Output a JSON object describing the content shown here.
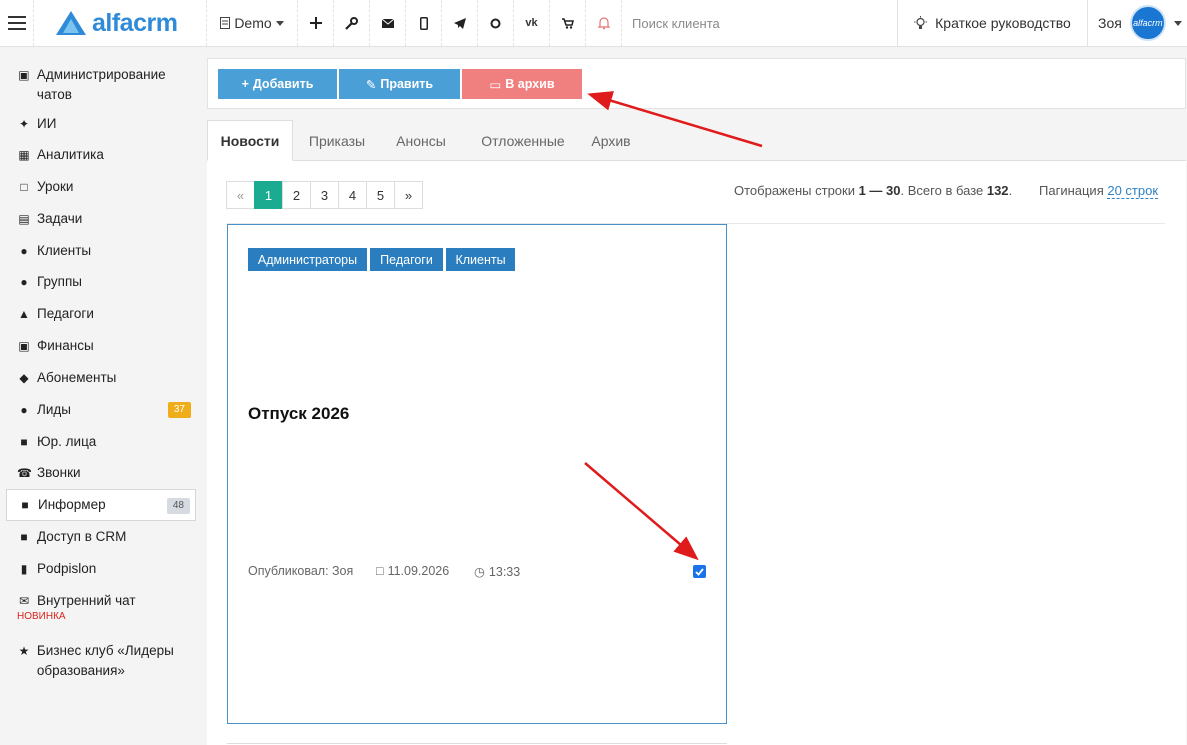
{
  "topbar": {
    "logo_text": "alfacrm",
    "branch": "Demo",
    "search_placeholder": "Поиск клиента",
    "guide_label": "Краткое руководство",
    "user_name": "Зоя",
    "avatar_text": "alfacrm"
  },
  "sidebar": {
    "items": [
      {
        "label": "Администрирование чатов",
        "icon": "chat-admin-icon"
      },
      {
        "label": "ИИ",
        "icon": "sparkle-icon"
      },
      {
        "label": "Аналитика",
        "icon": "map-icon"
      },
      {
        "label": "Уроки",
        "icon": "calendar-icon"
      },
      {
        "label": "Задачи",
        "icon": "clipboard-icon"
      },
      {
        "label": "Клиенты",
        "icon": "user-icon"
      },
      {
        "label": "Группы",
        "icon": "users-icon"
      },
      {
        "label": "Педагоги",
        "icon": "graduation-cap-icon"
      },
      {
        "label": "Финансы",
        "icon": "money-icon"
      },
      {
        "label": "Абонементы",
        "icon": "tag-icon"
      },
      {
        "label": "Лиды",
        "icon": "user-plus-icon",
        "badge": "37"
      },
      {
        "label": "Юр. лица",
        "icon": "briefcase-icon"
      },
      {
        "label": "Звонки",
        "icon": "phone-icon"
      },
      {
        "label": "Информер",
        "icon": "book-icon",
        "badge": "48"
      },
      {
        "label": "Доступ в CRM",
        "icon": "lock-icon"
      },
      {
        "label": "Podpislon",
        "icon": "file-icon"
      },
      {
        "label": "Внутренний чат",
        "icon": "envelope-icon",
        "note": "НОВИНКА"
      },
      {
        "label": "Бизнес клуб «Лидеры образования»",
        "icon": "star-icon"
      }
    ]
  },
  "toolbar": {
    "add_label": "Добавить",
    "edit_label": "Править",
    "archive_label": "В архив"
  },
  "tabs": [
    "Новости",
    "Приказы",
    "Анонсы",
    "Отложенные",
    "Архив"
  ],
  "pager": {
    "prev": "«",
    "pages": [
      "1",
      "2",
      "3",
      "4",
      "5"
    ],
    "next": "»",
    "current": "1"
  },
  "rows_info": {
    "prefix": "Отображены строки ",
    "range": "1 — 30",
    "middle": ". Всего в базе ",
    "total": "132",
    "suffix": "."
  },
  "pagination": {
    "label": "Пагинация ",
    "value": "20 строк"
  },
  "news_card": {
    "tags": [
      "Администраторы",
      "Педагоги",
      "Клиенты"
    ],
    "title": "Отпуск 2026",
    "author": "Опубликовал: Зоя",
    "date": "11.09.2026",
    "time": "13:33",
    "checked": true
  },
  "colors": {
    "brand": "#2f8bd8",
    "button_blue": "#4a9fd6",
    "button_red": "#f08080",
    "pager_active": "#1aab91",
    "tag_blue": "#2a7ec0",
    "annotation_arrow": "#e01b1b"
  }
}
